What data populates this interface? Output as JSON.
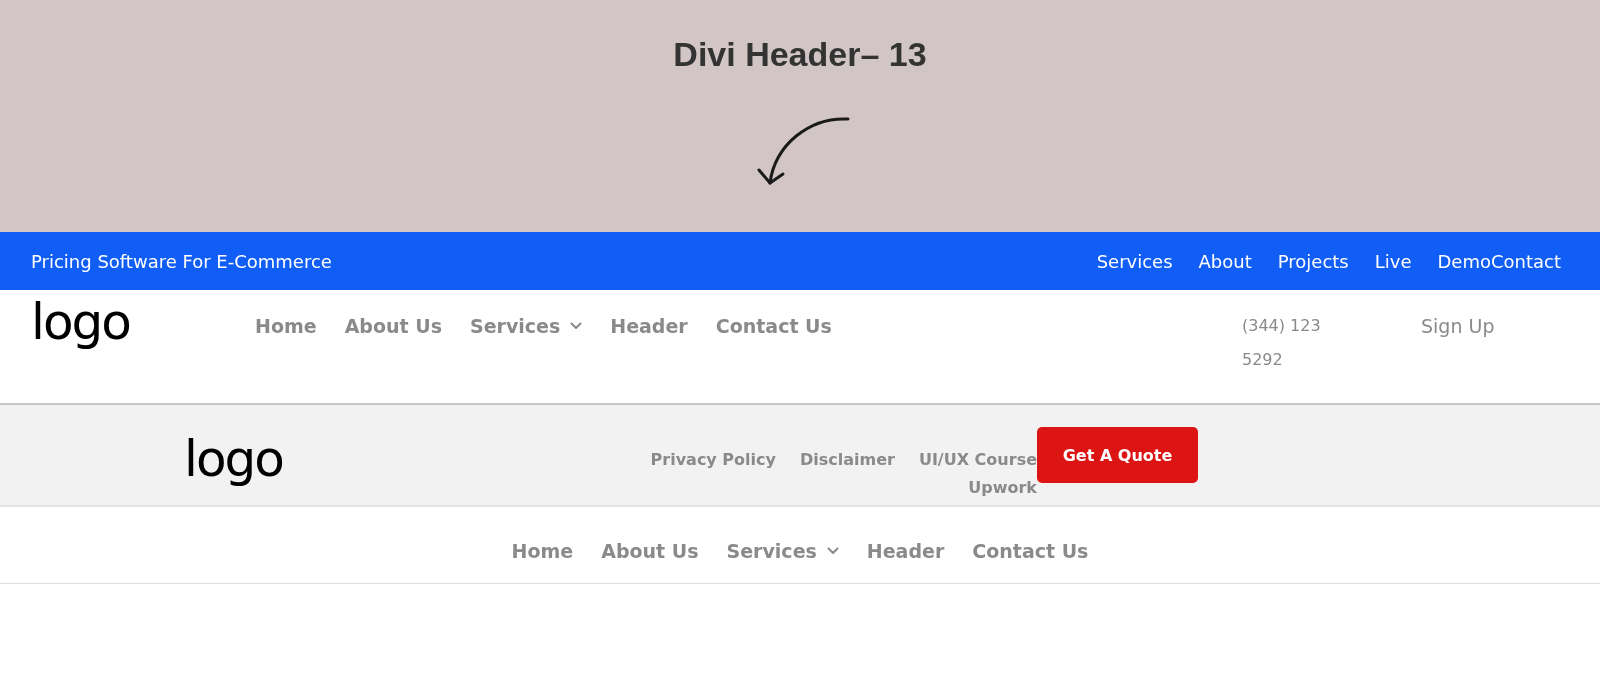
{
  "banner": {
    "title": "Divi Header– 13"
  },
  "top_bar": {
    "tagline": "Pricing Software For E-Commerce",
    "links": [
      "Services",
      "About",
      "Projects",
      "Live",
      "DemoContact"
    ]
  },
  "main_header": {
    "logo": "logo",
    "nav": [
      {
        "label": "Home",
        "dropdown": false
      },
      {
        "label": "About Us",
        "dropdown": false
      },
      {
        "label": "Services",
        "dropdown": true
      },
      {
        "label": "Header",
        "dropdown": false
      },
      {
        "label": "Contact Us",
        "dropdown": false
      }
    ],
    "phone": "(344) 123 5292",
    "sign_up": "Sign Up"
  },
  "footer_bar": {
    "logo": "logo",
    "links": [
      "Privacy Policy",
      "Disclaimer",
      "UI/UX Course",
      "Upwork"
    ],
    "button": "Get A Quote"
  },
  "bottom_nav": {
    "nav": [
      {
        "label": "Home",
        "dropdown": false
      },
      {
        "label": "About Us",
        "dropdown": false
      },
      {
        "label": "Services",
        "dropdown": true
      },
      {
        "label": "Header",
        "dropdown": false
      },
      {
        "label": "Contact Us",
        "dropdown": false
      }
    ]
  }
}
